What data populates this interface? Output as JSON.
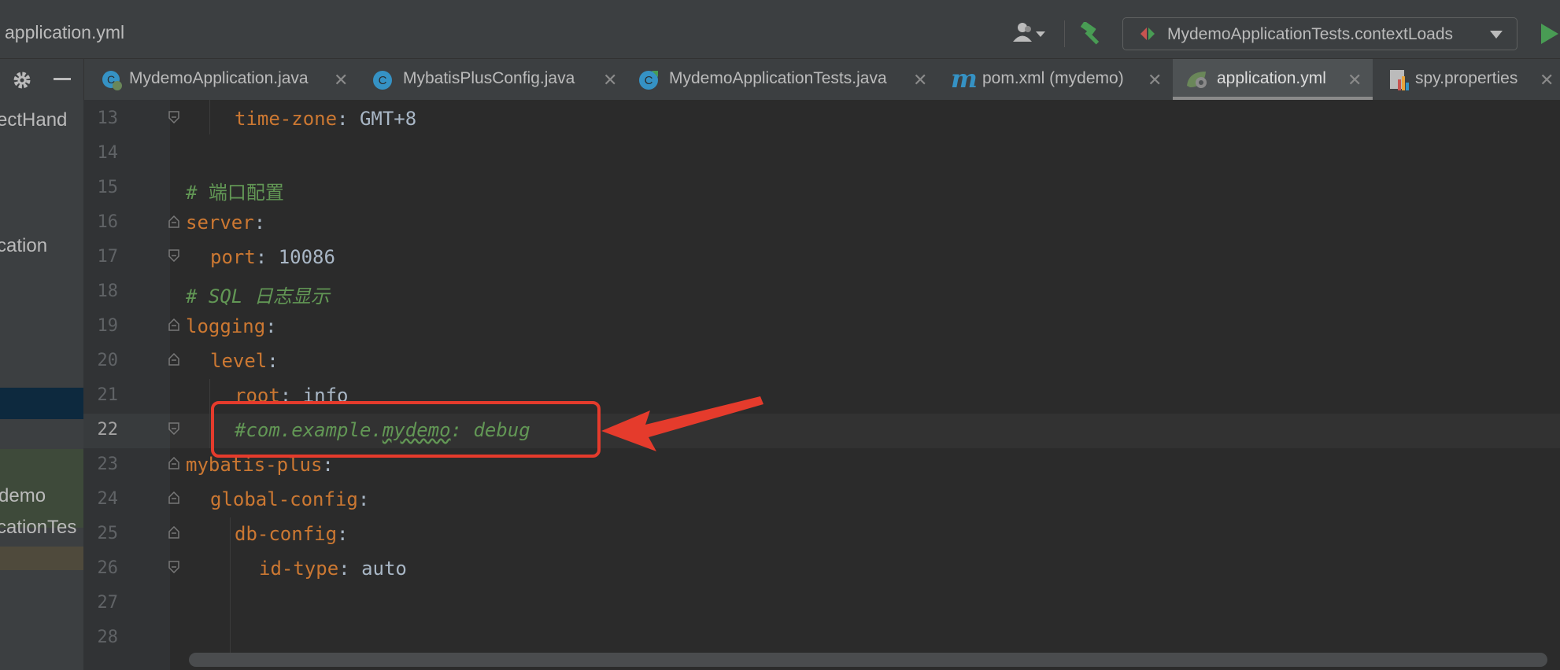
{
  "title_bar": {
    "file_name": "application.yml"
  },
  "toolbar": {
    "user_icon": "user-dropdown-icon",
    "build_icon": "hammer-icon",
    "run_config_label": "MydemoApplicationTests.contextLoads",
    "run_icon": "run-icon"
  },
  "tabs": [
    {
      "label": "MydemoApplication.java",
      "icon": "spring-class-icon"
    },
    {
      "label": "MybatisPlusConfig.java",
      "icon": "class-icon"
    },
    {
      "label": "MydemoApplicationTests.java",
      "icon": "test-class-icon"
    },
    {
      "label": "pom.xml (mydemo)",
      "icon": "maven-icon"
    },
    {
      "label": "application.yml",
      "icon": "spring-config-icon",
      "active": true
    },
    {
      "label": "spy.properties",
      "icon": "properties-icon"
    }
  ],
  "project_panel": {
    "items": [
      "ectHand",
      "cation",
      "demo",
      "cationTes"
    ]
  },
  "editor": {
    "line_numbers": [
      "13",
      "14",
      "15",
      "16",
      "17",
      "18",
      "19",
      "20",
      "21",
      "22",
      "23",
      "24",
      "25",
      "26",
      "27",
      "28"
    ],
    "current_line": "22",
    "lines": [
      {
        "key": "time-zone",
        "sep": ": ",
        "value": "GMT+8"
      },
      {},
      {
        "comment": "# 端口配置"
      },
      {
        "key": "server",
        "sep": ":"
      },
      {
        "key": "port",
        "sep": ": ",
        "value": "10086"
      },
      {
        "comment": "# SQL 日志显示"
      },
      {
        "key": "logging",
        "sep": ":"
      },
      {
        "key": "level",
        "sep": ":"
      },
      {
        "key": "root",
        "sep": ": ",
        "value": "info"
      },
      {
        "comment_parts": [
          "#com.example.",
          "mydemo",
          ": debug"
        ]
      },
      {
        "key": "mybatis-plus",
        "sep": ":"
      },
      {
        "key": "global-config",
        "sep": ":"
      },
      {
        "key": "db-config",
        "sep": ":"
      },
      {
        "key": "id-type",
        "sep": ": ",
        "value": "auto"
      },
      {},
      {}
    ]
  },
  "annotation": {
    "color": "#e53b2c"
  },
  "colors": {
    "keyword": "#cc7832",
    "comment": "#629755",
    "plain": "#a9b7c6",
    "background": "#2b2b2b"
  }
}
